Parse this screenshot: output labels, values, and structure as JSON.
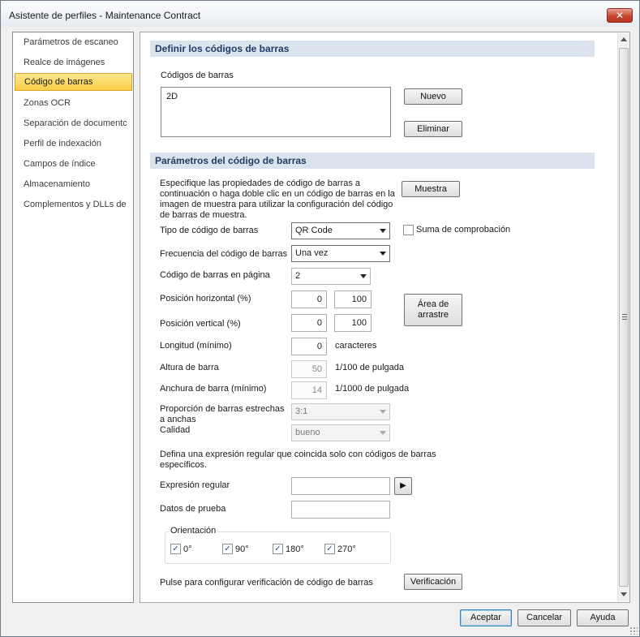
{
  "window": {
    "title": "Asistente de perfiles - Maintenance Contract",
    "close_label": "✕"
  },
  "sidebar": {
    "items": [
      {
        "label": "Parámetros de escaneo"
      },
      {
        "label": "Realce de imágenes"
      },
      {
        "label": "Código de barras",
        "selected": true
      },
      {
        "label": "Zonas OCR"
      },
      {
        "label": "Separación de documentc"
      },
      {
        "label": "Perfil de indexación"
      },
      {
        "label": "Campos de índice"
      },
      {
        "label": "Almacenamiento"
      },
      {
        "label": "Complementos y DLLs de"
      }
    ]
  },
  "define_section": {
    "header": "Definir los códigos de barras",
    "list_label": "Códigos de barras",
    "list_items": [
      "2D"
    ],
    "new_button": "Nuevo",
    "delete_button": "Eliminar"
  },
  "params_section": {
    "header": "Parámetros del código de barras",
    "description": "Especifique las propiedades de código de barras a continuación o haga doble clic en un código de barras en la imagen de muestra para utilizar la configuración del código de barras de muestra.",
    "sample_button": "Muestra",
    "type_label": "Tipo de código de barras",
    "type_value": "QR Code",
    "checksum_label": "Suma de comprobación",
    "checksum_checked": false,
    "frequency_label": "Frecuencia del código de barras",
    "frequency_value": "Una vez",
    "per_page_label": "Código de barras en página",
    "per_page_value": "2",
    "horizontal_label": "Posición horizontal (%)",
    "horizontal_from": "0",
    "horizontal_to": "100",
    "vertical_label": "Posición vertical (%)",
    "vertical_from": "0",
    "vertical_to": "100",
    "drag_area_button_line1": "Área de",
    "drag_area_button_line2": "arrastre",
    "length_label": "Longitud (mínimo)",
    "length_value": "0",
    "length_unit": "caracteres",
    "bar_height_label": "Altura de barra",
    "bar_height_value": "50",
    "bar_height_unit": "1/100 de pulgada",
    "bar_width_label": "Anchura de barra (mínimo)",
    "bar_width_value": "14",
    "bar_width_unit": "1/1000 de pulgada",
    "ratio_label_line1": "Proporción de barras estrechas",
    "ratio_label_line2": "a anchas",
    "ratio_value": "3:1",
    "quality_label": "Calidad",
    "quality_value": "bueno",
    "regex_intro": "Defina una expresión regular que coincida solo con códigos de barras específicos.",
    "regex_label": "Expresión regular",
    "regex_value": "",
    "test_data_label": "Datos de prueba",
    "test_data_value": "",
    "orientation_label": "Orientación",
    "orientations": [
      {
        "label": "0°",
        "checked": true
      },
      {
        "label": "90°",
        "checked": true
      },
      {
        "label": "180°",
        "checked": true
      },
      {
        "label": "270°",
        "checked": true
      }
    ],
    "verification_text": "Pulse para configurar verificación de código de barras",
    "verification_button": "Verificación"
  },
  "footer": {
    "accept_button": "Aceptar",
    "cancel_button": "Cancelar",
    "help_button": "Ayuda"
  },
  "colors": {
    "section_header_bg": "#dbe4ee",
    "section_header_text": "#1f3c64",
    "selected_item": "#f9cf45"
  }
}
